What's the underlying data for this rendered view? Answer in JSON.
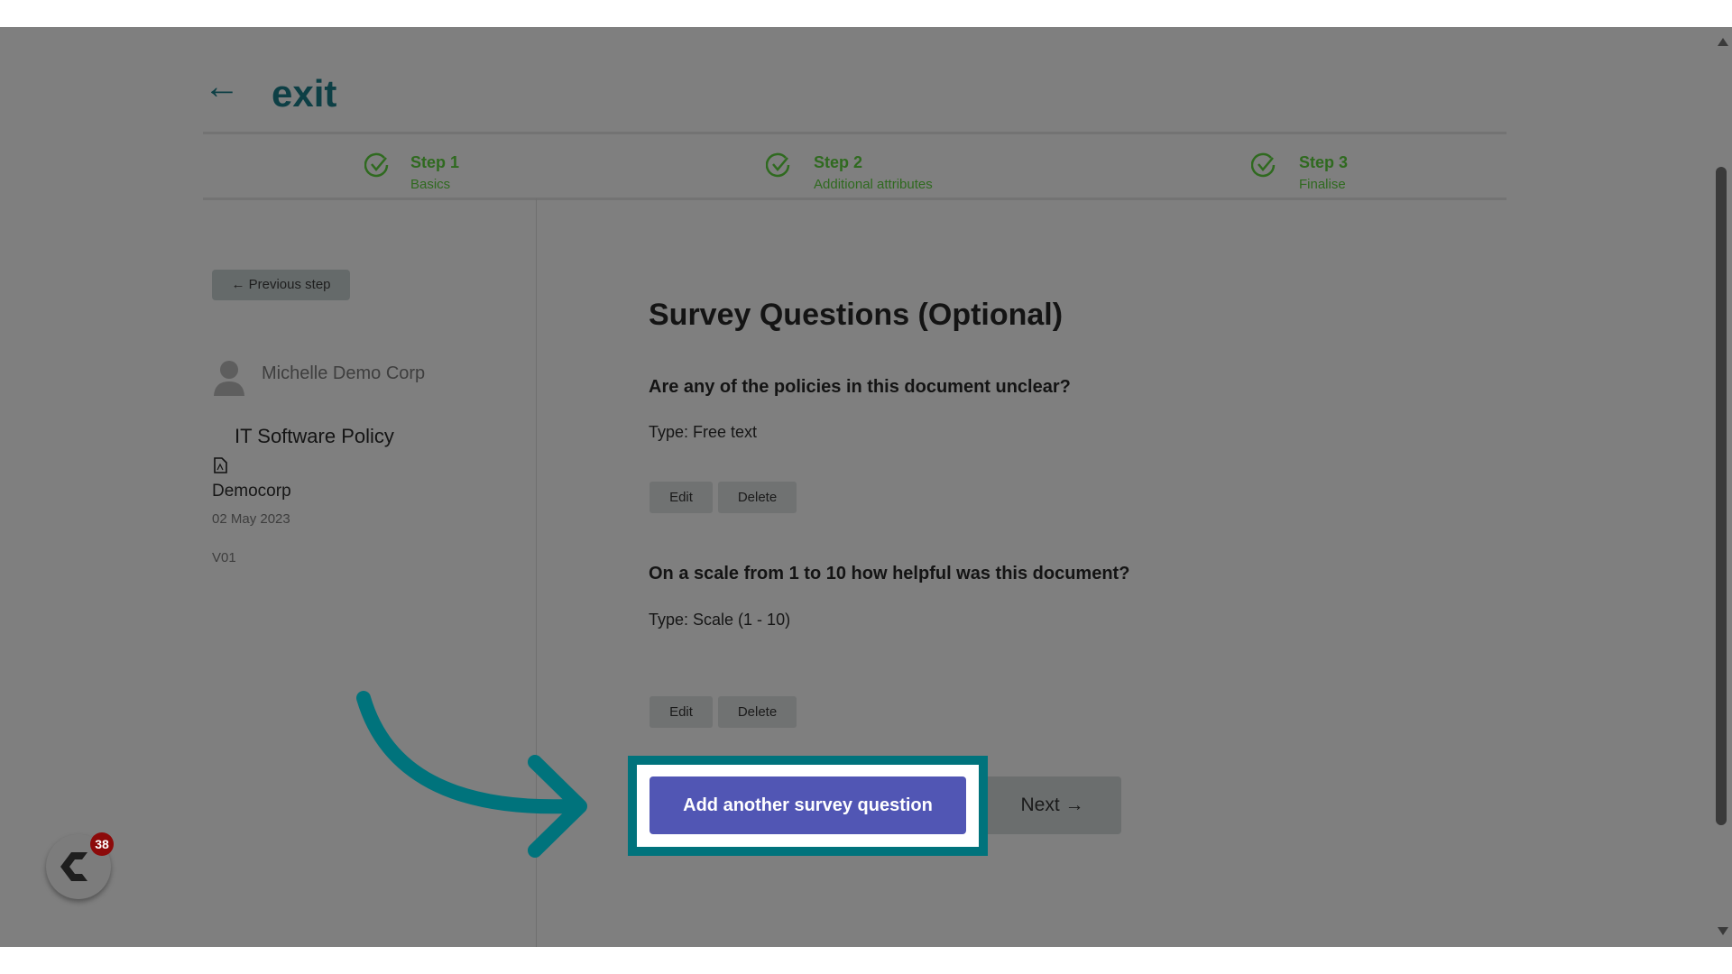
{
  "header": {
    "back_icon": "arrow-left",
    "exit_label": "exit"
  },
  "steps": [
    {
      "title": "Step 1",
      "subtitle": "Basics",
      "icon": "check-circle",
      "color": "#2f6a1f"
    },
    {
      "title": "Step 2",
      "subtitle": "Additional attributes",
      "icon": "check-circle",
      "color": "#2f6a1f"
    },
    {
      "title": "Step 3",
      "subtitle": "Finalise",
      "icon": "check-circle",
      "color": "#2f6a1f"
    }
  ],
  "sidebar": {
    "previous_label": "← Previous step",
    "user_name": "Michelle Demo Corp",
    "document_title": "IT Software Policy",
    "organization": "Democorp",
    "date": "02 May 2023",
    "version": "V01"
  },
  "main": {
    "title": "Survey Questions (Optional)",
    "questions": [
      {
        "text": "Are any of the policies in this document unclear?",
        "type": "Type: Free text",
        "edit_label": "Edit",
        "delete_label": "Delete"
      },
      {
        "text": "On a scale from 1 to 10 how helpful was this document?",
        "type": "Type: Scale (1 - 10)",
        "edit_label": "Edit",
        "delete_label": "Delete"
      }
    ],
    "add_label": "Add another survey question",
    "next_label": "Next →"
  },
  "widget": {
    "badge_count": "38",
    "badge_color": "#8c0a0a"
  },
  "colors": {
    "accent": "#5156b4",
    "highlight": "#00737c",
    "overlay": "#7f7f7f"
  }
}
